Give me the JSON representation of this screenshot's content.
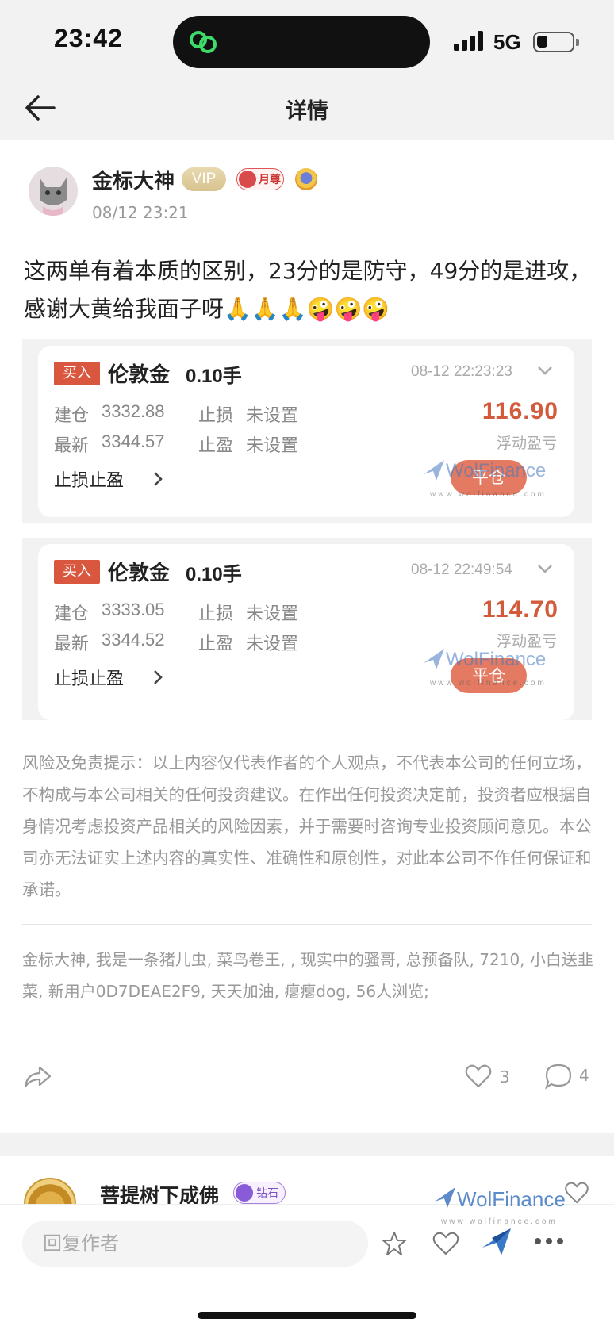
{
  "status_bar": {
    "time": "23:42",
    "network": "5G",
    "battery_level": 0.3
  },
  "nav": {
    "title": "详情"
  },
  "post": {
    "author": "金标大神",
    "vip_label": "VIP",
    "month_badge": "月尊",
    "timestamp": "08/12 23:21",
    "content": "这两单有着本质的区别，23分的是防守，49分的是进攻，感谢大黄给我面子呀🙏🙏🙏🤪🤪🤪"
  },
  "trades": [
    {
      "side": "买入",
      "product": "伦敦金",
      "lots": "0.10手",
      "time": "08-12 22:23:23",
      "open_label": "建仓",
      "open_price": "3332.88",
      "sl_label": "止损",
      "sl_value": "未设置",
      "latest_label": "最新",
      "latest_price": "3344.57",
      "tp_label": "止盈",
      "tp_value": "未设置",
      "pnl": "116.90",
      "pnl_label": "浮动盈亏",
      "sltp_label": "止损止盈",
      "close_label": "平仓"
    },
    {
      "side": "买入",
      "product": "伦敦金",
      "lots": "0.10手",
      "time": "08-12 22:49:54",
      "open_label": "建仓",
      "open_price": "3333.05",
      "sl_label": "止损",
      "sl_value": "未设置",
      "latest_label": "最新",
      "latest_price": "3344.52",
      "tp_label": "止盈",
      "tp_value": "未设置",
      "pnl": "114.70",
      "pnl_label": "浮动盈亏",
      "sltp_label": "止损止盈",
      "close_label": "平仓"
    }
  ],
  "watermark": {
    "brand": "WolFinance",
    "url": "www.wolfinance.com"
  },
  "disclaimer": "风险及免责提示：以上内容仅代表作者的个人观点，不代表本公司的任何立场，不构成与本公司相关的任何投资建议。在作出任何投资决定前，投资者应根据自身情况考虑投资产品相关的风险因素，并于需要时咨询专业投资顾问意见。本公司亦无法证实上述内容的真实性、准确性和原创性，对此本公司不作任何保证和承诺。",
  "viewers": "金标大神, 我是一条猪儿虫, 菜鸟卷王, , 现实中的骚哥, 总预备队, 7210, 小白送韭菜, 新用户0D7DEAE2F9, 天天加油, 瘪瘪dog, 56人浏览;",
  "actions": {
    "likes": "3",
    "comments": "4"
  },
  "comment": {
    "author": "菩提树下成佛",
    "badge": "钻石"
  },
  "bottom_bar": {
    "reply_placeholder": "回复作者"
  },
  "colors": {
    "accent": "#d35a3a",
    "buy_tag": "#d8573e",
    "close_button": "#e47a62",
    "watermark": "#4678be"
  },
  "icons": [
    "back-arrow-icon",
    "chevron-down-icon",
    "chevron-right-icon",
    "share-icon",
    "heart-icon",
    "comment-icon",
    "star-icon",
    "wolfinance-bird-icon",
    "more-icon"
  ]
}
